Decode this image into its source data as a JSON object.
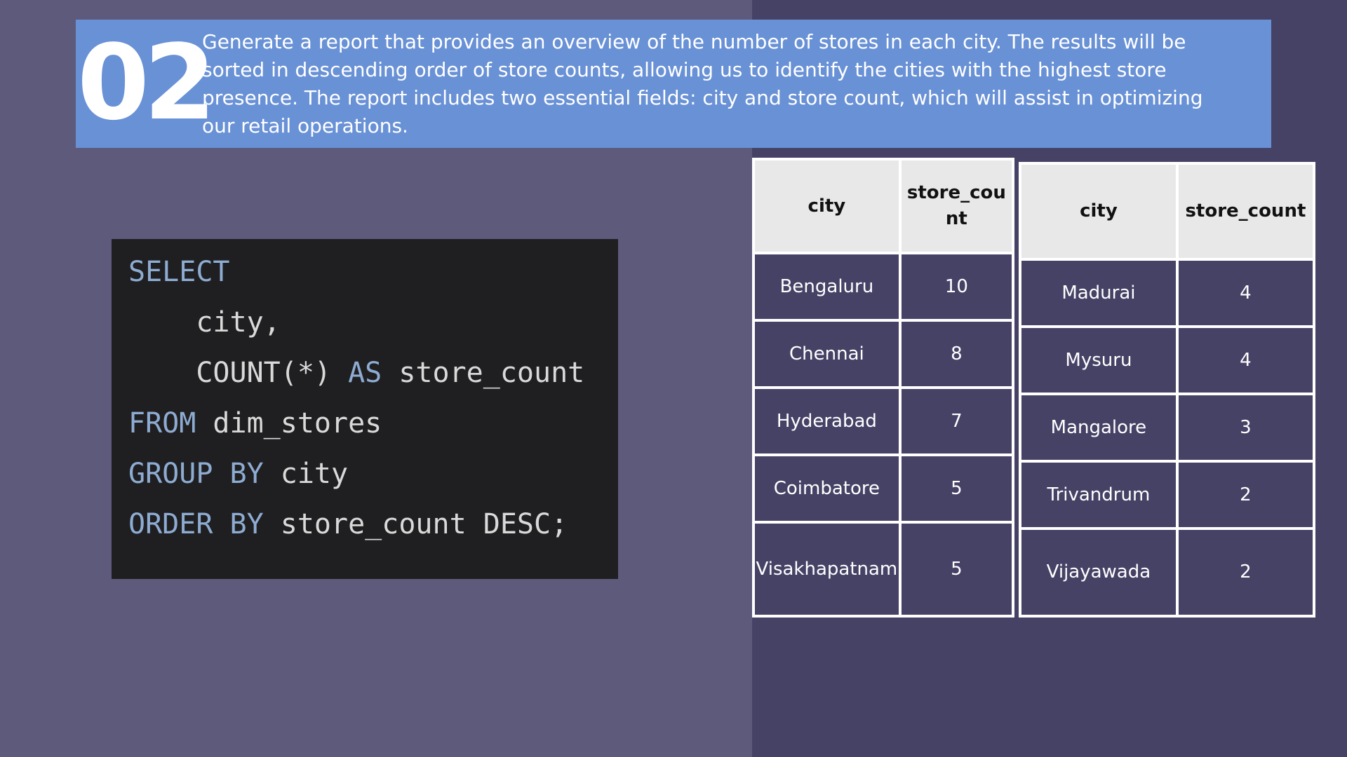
{
  "banner": {
    "number": "02",
    "description": "Generate a report that provides an overview of the number of stores in each city. The results will be sorted in descending order of store counts, allowing us to identify the cities with the highest store presence. The report includes two essential fields: city and store count, which will assist in optimizing our retail operations."
  },
  "code": {
    "line1_kw": "SELECT",
    "line2": "    city,",
    "line3_pre": "    COUNT(*) ",
    "line3_kw": "AS",
    "line3_post": " store_count",
    "line4_kw": "FROM",
    "line4_post": " dim_stores",
    "line5_kw1": "GROUP",
    "line5_kw2": "BY",
    "line5_post": " city",
    "line6_kw1": "ORDER",
    "line6_kw2": "BY",
    "line6_post": " store_count DESC;"
  },
  "table_left": {
    "headers": [
      "city",
      "store_count"
    ],
    "rows": [
      [
        "Bengaluru",
        "10"
      ],
      [
        "Chennai",
        "8"
      ],
      [
        "Hyderabad",
        "7"
      ],
      [
        "Coimbatore",
        "5"
      ],
      [
        "Visakhapatnam",
        "5"
      ]
    ]
  },
  "table_right": {
    "headers": [
      "city",
      "store_count"
    ],
    "rows": [
      [
        "Madurai",
        "4"
      ],
      [
        "Mysuru",
        "4"
      ],
      [
        "Mangalore",
        "3"
      ],
      [
        "Trivandrum",
        "2"
      ],
      [
        "Vijayawada",
        "2"
      ]
    ]
  },
  "colors": {
    "background": "#5e5a7b",
    "right_panel": "#464266",
    "banner": "#6991d6",
    "code_background": "#1f1f21",
    "code_keyword": "#8eacd2",
    "code_text": "#d9d9d9",
    "table_header": "#e8e8e8",
    "table_cell": "#464266"
  }
}
